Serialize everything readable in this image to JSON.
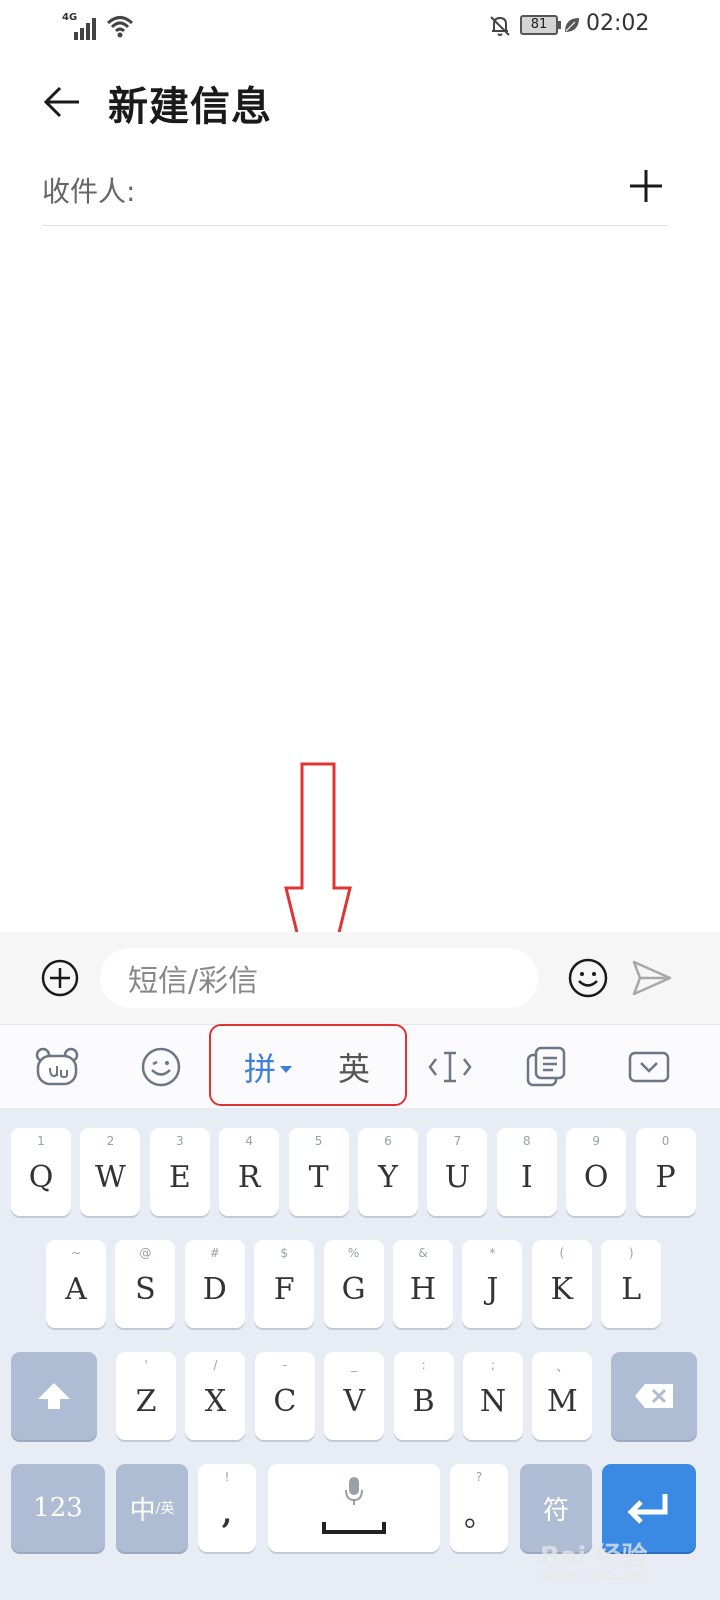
{
  "status_bar": {
    "network_type": "4G",
    "battery_level": "81",
    "time": "02:02"
  },
  "header": {
    "title": "新建信息"
  },
  "recipient": {
    "label": "收件人:"
  },
  "compose": {
    "placeholder": "短信/彩信"
  },
  "keyboard_toolbar": {
    "pinyin_label": "拼",
    "english_label": "英"
  },
  "keyboard": {
    "row1": [
      {
        "key": "Q",
        "hint": "1"
      },
      {
        "key": "W",
        "hint": "2"
      },
      {
        "key": "E",
        "hint": "3"
      },
      {
        "key": "R",
        "hint": "4"
      },
      {
        "key": "T",
        "hint": "5"
      },
      {
        "key": "Y",
        "hint": "6"
      },
      {
        "key": "U",
        "hint": "7"
      },
      {
        "key": "I",
        "hint": "8"
      },
      {
        "key": "O",
        "hint": "9"
      },
      {
        "key": "P",
        "hint": "0"
      }
    ],
    "row2": [
      {
        "key": "A",
        "hint": "~"
      },
      {
        "key": "S",
        "hint": "@"
      },
      {
        "key": "D",
        "hint": "#"
      },
      {
        "key": "F",
        "hint": "$"
      },
      {
        "key": "G",
        "hint": "%"
      },
      {
        "key": "H",
        "hint": "&"
      },
      {
        "key": "J",
        "hint": "*"
      },
      {
        "key": "K",
        "hint": "("
      },
      {
        "key": "L",
        "hint": ")"
      }
    ],
    "row3": [
      {
        "key": "Z",
        "hint": "'"
      },
      {
        "key": "X",
        "hint": "/"
      },
      {
        "key": "C",
        "hint": "-"
      },
      {
        "key": "V",
        "hint": "_"
      },
      {
        "key": "B",
        "hint": ":"
      },
      {
        "key": "N",
        "hint": ";"
      },
      {
        "key": "M",
        "hint": "、"
      }
    ],
    "num_label": "123",
    "lang_label": "中",
    "lang_sub": "/英",
    "comma_label": ",",
    "comma_hint": "!",
    "period_label": "。",
    "period_hint": "?",
    "symbol_label": "符"
  },
  "watermark": {
    "brand": "Bai 经验",
    "url": "jingyan.baidu.com"
  },
  "colors": {
    "accent_blue": "#3a8ae4",
    "annotation_red": "#e03434",
    "function_key": "#aebcd4",
    "keyboard_bg": "#e8ecf5"
  }
}
